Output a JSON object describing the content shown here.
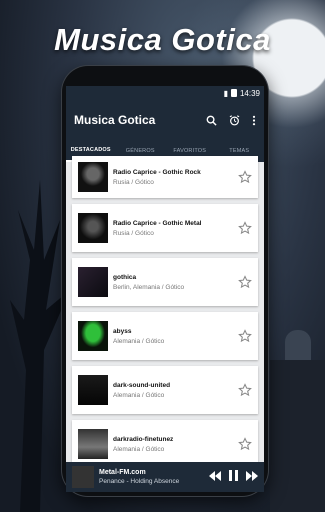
{
  "promo": {
    "headline": "Musica Gotica"
  },
  "status": {
    "time": "14:39"
  },
  "appbar": {
    "title": "Musica Gotica"
  },
  "tabs": [
    {
      "label": "Destacados",
      "active": true
    },
    {
      "label": "Géneros",
      "active": false
    },
    {
      "label": "Favoritos",
      "active": false
    },
    {
      "label": "Temas",
      "active": false
    }
  ],
  "stations": [
    {
      "name": "Radio Caprice - Gothic Rock",
      "sub": "Rusia / Gótico"
    },
    {
      "name": "Radio Caprice - Gothic Metal",
      "sub": "Rusia / Gótico"
    },
    {
      "name": "gothica",
      "sub": "Berlin, Alemania / Gótico"
    },
    {
      "name": "abyss",
      "sub": "Alemania / Gótico"
    },
    {
      "name": "dark-sound-united",
      "sub": "Alemania / Gótico"
    },
    {
      "name": "darkradio-finetunez",
      "sub": "Alemania / Gótico"
    }
  ],
  "player": {
    "station": "Metal-FM.com",
    "track": "Penance - Holding Absence"
  },
  "colors": {
    "appbar": "#1e2a38",
    "abyss_logo": "#2fbf3a"
  },
  "icons": {
    "search": "search-icon",
    "alarm": "alarm-icon",
    "more": "more-vert-icon",
    "star": "star-outline-icon",
    "rewind": "rewind-icon",
    "pause": "pause-icon",
    "forward": "fast-forward-icon"
  }
}
